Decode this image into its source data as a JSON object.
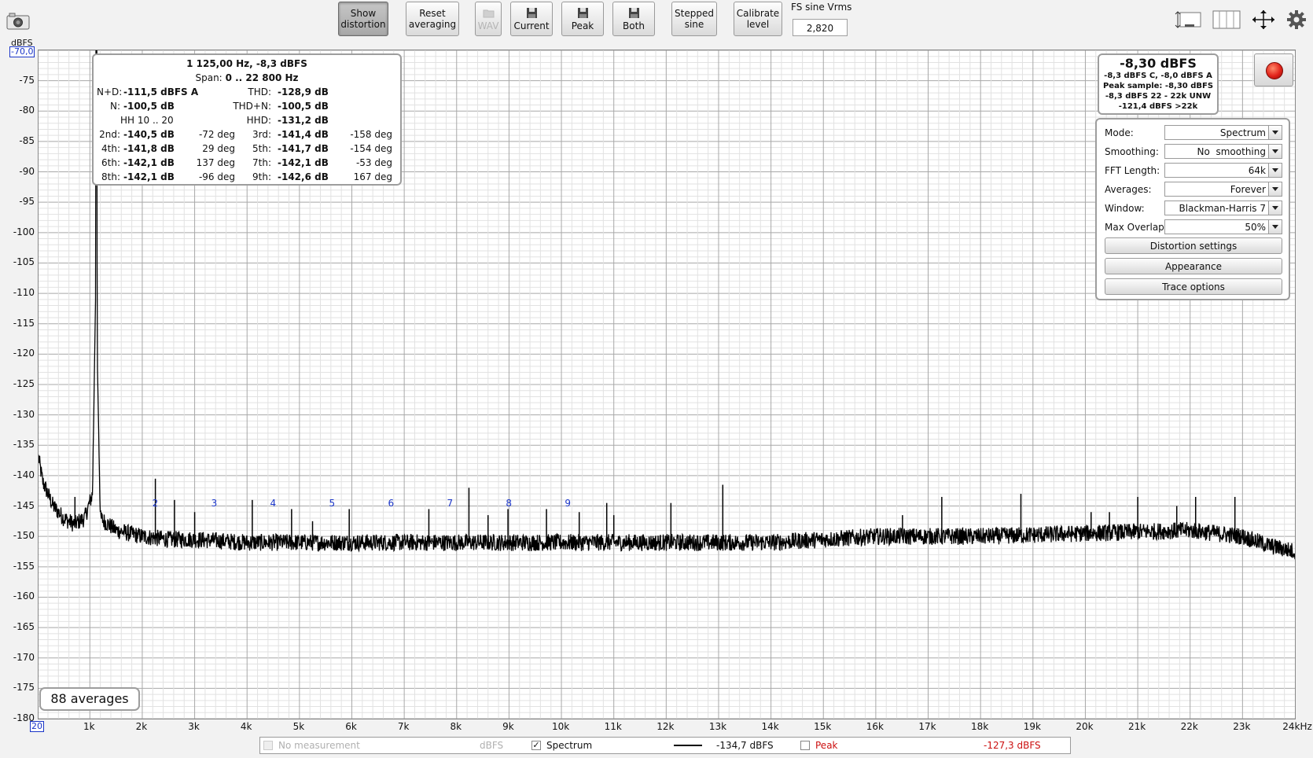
{
  "toolbar": {
    "show_distortion": [
      "Show",
      "distortion"
    ],
    "reset_averaging": [
      "Reset",
      "averaging"
    ],
    "wav": "WAV",
    "current": "Current",
    "peak": "Peak",
    "both": "Both",
    "stepped_sine": [
      "Stepped",
      "sine"
    ],
    "calibrate_level": [
      "Calibrate",
      "level"
    ],
    "fs_label": "FS sine Vrms",
    "fs_value": "2,820"
  },
  "icons": {
    "snapshot": "camera-icon",
    "split_view": "layout-icon",
    "panel_view": "panels-icon",
    "pan": "move-arrows-icon",
    "settings": "gear-icon"
  },
  "axes": {
    "y_unit": "dBFS",
    "y_top_value": "-70,0",
    "x_min_value": "20",
    "y_ticks": [
      "-75",
      "-80",
      "-85",
      "-90",
      "-95",
      "-100",
      "-105",
      "-110",
      "-115",
      "-120",
      "-125",
      "-130",
      "-135",
      "-140",
      "-145",
      "-150",
      "-155",
      "-160",
      "-165",
      "-170",
      "-175",
      "-180"
    ],
    "x_ticks": [
      "1k",
      "2k",
      "3k",
      "4k",
      "5k",
      "6k",
      "7k",
      "8k",
      "9k",
      "10k",
      "11k",
      "12k",
      "13k",
      "14k",
      "15k",
      "16k",
      "17k",
      "18k",
      "19k",
      "20k",
      "21k",
      "22k",
      "23k",
      "24kHz"
    ]
  },
  "distortion": {
    "title": "1 125,00 Hz, -8,3 dBFS",
    "span_label": "Span:",
    "span_value": "0 .. 22 800 Hz",
    "nd_label": "N+D:",
    "nd_value": "-111,5 dBFS A",
    "thd_label": "THD:",
    "thd_value": "-128,9 dB",
    "n_label": "N:",
    "n_value": "-100,5 dB",
    "thdn_label": "THD+N:",
    "thdn_value": "-100,5 dB",
    "hh_label": "HH 10 .. 20",
    "hhd_label": "HHD:",
    "hhd_value": "-131,2 dB",
    "harmonics": [
      {
        "l": "2nd:",
        "v": "-140,5 dB",
        "p": "-72 deg",
        "l2": "3rd:",
        "v2": "-141,4 dB",
        "p2": "-158 deg"
      },
      {
        "l": "4th:",
        "v": "-141,8 dB",
        "p": "29 deg",
        "l2": "5th:",
        "v2": "-141,7 dB",
        "p2": "-154 deg"
      },
      {
        "l": "6th:",
        "v": "-142,1 dB",
        "p": "137 deg",
        "l2": "7th:",
        "v2": "-142,1 dB",
        "p2": "-53 deg"
      },
      {
        "l": "8th:",
        "v": "-142,1 dB",
        "p": "-96 deg",
        "l2": "9th:",
        "v2": "-142,6 dB",
        "p2": "167 deg"
      }
    ]
  },
  "level": {
    "main": "-8,30 dBFS",
    "l1": "-8,3 dBFS C, -8,0 dBFS A",
    "l2": "Peak sample: -8,30 dBFS",
    "l3": "-8,3 dBFS 22 - 22k UNW",
    "l4": "-121,4 dBFS >22k"
  },
  "controls": {
    "mode_label": "Mode:",
    "mode_value": "Spectrum",
    "smoothing_label": "Smoothing:",
    "smoothing_value": "No  smoothing",
    "fft_label": "FFT Length:",
    "fft_value": "64k",
    "averages_label": "Averages:",
    "averages_value": "Forever",
    "window_label": "Window:",
    "window_value": "Blackman-Harris 7",
    "overlap_label": "Max Overlap:",
    "overlap_value": "50%",
    "distortion_settings": "Distortion settings",
    "appearance": "Appearance",
    "trace_options": "Trace options"
  },
  "averages_badge": "88 averages",
  "legend": {
    "no_measurement": "No measurement",
    "no_measurement_unit": "dBFS",
    "spectrum": "Spectrum",
    "spectrum_checked": true,
    "spectrum_value": "-134,7 dBFS",
    "peak": "Peak",
    "peak_checked": false,
    "peak_value": "-127,3 dBFS"
  },
  "colors": {
    "trace": "#000000",
    "harmonic_markers": "#1a35c8",
    "peak_text": "#cc1010",
    "record": "#e2231a"
  },
  "chart_data": {
    "type": "line",
    "title": "",
    "xlabel": "",
    "ylabel": "dBFS",
    "xlim": [
      20,
      24000
    ],
    "ylim": [
      -180,
      -70
    ],
    "x_scale": "linear",
    "grid": true,
    "series": [
      {
        "name": "Spectrum",
        "x": [
          20,
          100,
          300,
          500,
          700,
          900,
          1050,
          1110,
          1125,
          1140,
          1200,
          1500,
          2000,
          2500,
          3000,
          4000,
          5000,
          6000,
          8000,
          10000,
          12000,
          14000,
          16000,
          18000,
          20000,
          22000,
          23000,
          23500,
          24000
        ],
        "y": [
          -137,
          -141,
          -145,
          -147,
          -148,
          -147,
          -143,
          -110,
          -8.3,
          -120,
          -147,
          -149,
          -150,
          -150.5,
          -150.5,
          -151,
          -151,
          -151,
          -151,
          -151,
          -151,
          -151,
          -150,
          -150,
          -149.5,
          -149,
          -150,
          -151.5,
          -152.5
        ]
      }
    ],
    "spurs": [
      {
        "x": 715,
        "y": -143.5
      },
      {
        "x": 2250,
        "y": -140.5
      },
      {
        "x": 2615,
        "y": -144
      },
      {
        "x": 3000,
        "y": -146
      },
      {
        "x": 4100,
        "y": -144
      },
      {
        "x": 4850,
        "y": -145.5
      },
      {
        "x": 5250,
        "y": -147.5
      },
      {
        "x": 5950,
        "y": -145.5
      },
      {
        "x": 7470,
        "y": -145.5
      },
      {
        "x": 8235,
        "y": -142
      },
      {
        "x": 8600,
        "y": -146.5
      },
      {
        "x": 8980,
        "y": -145.5
      },
      {
        "x": 9715,
        "y": -145.5
      },
      {
        "x": 10340,
        "y": -146
      },
      {
        "x": 10865,
        "y": -144.5
      },
      {
        "x": 11000,
        "y": -146.5
      },
      {
        "x": 12090,
        "y": -144.5
      },
      {
        "x": 13080,
        "y": -141.5
      },
      {
        "x": 16510,
        "y": -146.5
      },
      {
        "x": 17260,
        "y": -143.5
      },
      {
        "x": 18770,
        "y": -143
      },
      {
        "x": 20110,
        "y": -146
      },
      {
        "x": 20460,
        "y": -146
      },
      {
        "x": 21000,
        "y": -143.5
      },
      {
        "x": 21745,
        "y": -145
      },
      {
        "x": 22105,
        "y": -143.5
      },
      {
        "x": 22855,
        "y": -143.5
      }
    ],
    "harmonic_labels": [
      {
        "label": "2",
        "x": 2250
      },
      {
        "label": "3",
        "x": 3375
      },
      {
        "label": "4",
        "x": 4500
      },
      {
        "label": "5",
        "x": 5625
      },
      {
        "label": "6",
        "x": 6750
      },
      {
        "label": "7",
        "x": 7875
      },
      {
        "label": "8",
        "x": 9000
      },
      {
        "label": "9",
        "x": 10125
      }
    ]
  }
}
